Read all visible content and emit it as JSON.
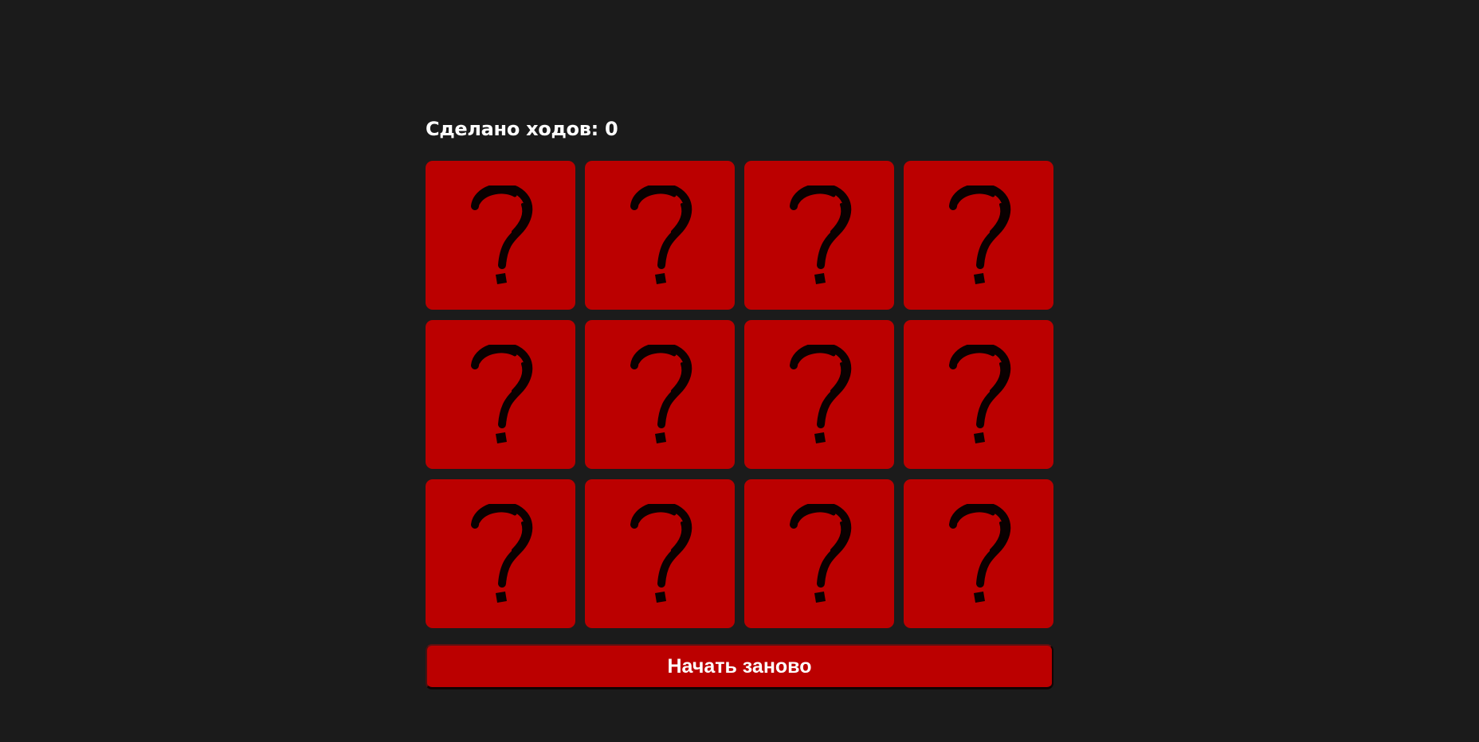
{
  "game": {
    "moves_label": "Сделано ходов: 0",
    "card_count": 12,
    "card_face_icon": "question-mark-icon",
    "card_color": "#bb0000",
    "background_color": "#1b1b1b",
    "restart_label": "Начать заново"
  }
}
